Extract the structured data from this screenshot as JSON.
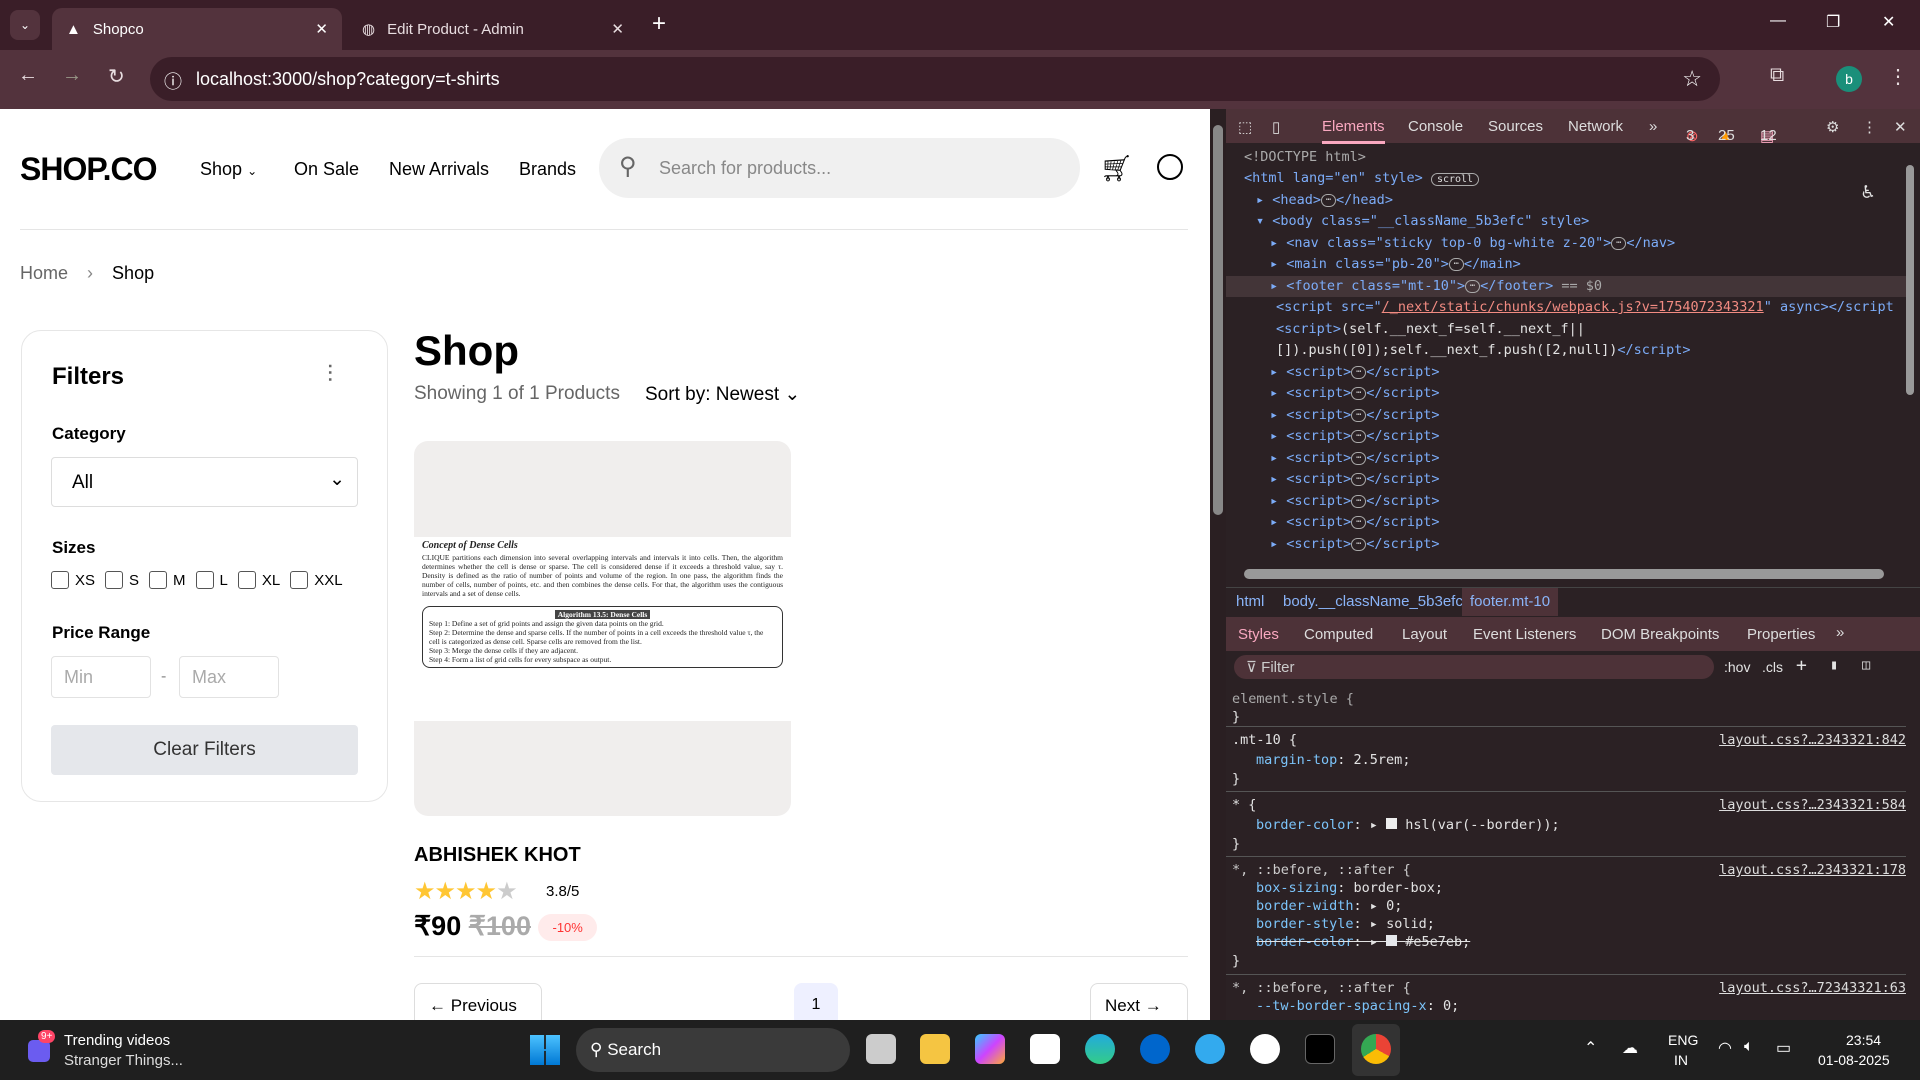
{
  "browser": {
    "tabs": [
      {
        "title": "Shopco",
        "active": true
      },
      {
        "title": "Edit Product - Admin",
        "active": false
      }
    ],
    "url": "localhost:3000/shop?category=t-shirts",
    "profile_initial": "b"
  },
  "site": {
    "logo": "SHOP.CO",
    "nav": [
      "Shop",
      "On Sale",
      "New Arrivals",
      "Brands"
    ],
    "search_placeholder": "Search for products...",
    "breadcrumb": [
      "Home",
      "Shop"
    ],
    "filters": {
      "title": "Filters",
      "category_label": "Category",
      "category_value": "All",
      "sizes_label": "Sizes",
      "sizes": [
        "XS",
        "S",
        "M",
        "L",
        "XL",
        "XXL"
      ],
      "price_label": "Price Range",
      "min_placeholder": "Min",
      "max_placeholder": "Max",
      "separator": "-",
      "clear": "Clear Filters"
    },
    "shop": {
      "title": "Shop",
      "showing": "Showing 1 of 1 Products",
      "sort_label": "Sort by:",
      "sort_value": "Newest"
    },
    "product": {
      "name": "ABHISHEK KHOT",
      "rating": 3.8,
      "rating_text": "3.8/5",
      "price": "₹90",
      "old_price": "₹100",
      "discount": "-10%",
      "image_text": {
        "heading": "Concept of Dense Cells",
        "para": "CLIQUE partitions each dimension into several overlapping intervals and intervals it into cells. Then, the algorithm determines whether the cell is dense or sparse. The cell is considered dense if it exceeds a threshold value, say τ. Density is defined as the ratio of number of points and volume of the region. In one pass, the algorithm finds the number of cells, number of points, etc. and then combines the dense cells. For that, the algorithm uses the contiguous intervals and a set of dense cells.",
        "algo_title": "Algorithm 13.5: Dense Cells",
        "steps": [
          "Step 1: Define a set of grid points and assign the given data points on the grid.",
          "Step 2: Determine the dense and sparse cells. If the number of points in a cell exceeds the threshold value τ, the cell is categorized as dense cell. Sparse cells are removed from the list.",
          "Step 3: Merge the dense cells if they are adjacent.",
          "Step 4: Form a list of grid cells for every subspace as output."
        ]
      }
    },
    "pagination": {
      "prev": "Previous",
      "page": "1",
      "next": "Next"
    }
  },
  "devtools": {
    "tabs": [
      "Elements",
      "Console",
      "Sources",
      "Network"
    ],
    "errors": "3",
    "warnings": "25",
    "messages": "12",
    "dom": [
      "<!DOCTYPE html>",
      "<html lang=\"en\" style>",
      "<head>",
      "<body class=\"__className_5b3efc\" style>",
      "<nav class=\"sticky top-0 bg-white z-20\">",
      "<main class=\"pb-20\">",
      "<footer class=\"mt-10\">",
      "/_next/static/chunks/webpack.js?v=1754072343321",
      "(self.__next_f=self.__next_f||",
      "[]).push([0]);self.__next_f.push([2,null])",
      "<script>"
    ],
    "scroll_badge": "scroll",
    "selected_suffix": "== $0",
    "crumbs": [
      "html",
      "body.__className_5b3efc",
      "footer.mt-10"
    ],
    "style_tabs": [
      "Styles",
      "Computed",
      "Layout",
      "Event Listeners",
      "DOM Breakpoints",
      "Properties"
    ],
    "filter_placeholder": "Filter",
    "hov": ":hov",
    "cls": ".cls",
    "rules": [
      {
        "selector": "element.style {",
        "source": "",
        "props": []
      },
      {
        "selector": ".mt-10 {",
        "source": "layout.css?…2343321:842",
        "props": [
          {
            "n": "margin-top",
            "v": "2.5rem;"
          }
        ]
      },
      {
        "selector": "* {",
        "source": "layout.css?…2343321:584",
        "props": [
          {
            "n": "border-color",
            "v": "hsl(var(--border));"
          }
        ]
      },
      {
        "selector": "*, ::before, ::after {",
        "source": "layout.css?…2343321:178",
        "props": [
          {
            "n": "box-sizing",
            "v": "border-box;"
          },
          {
            "n": "border-width",
            "v": "0;"
          },
          {
            "n": "border-style",
            "v": "solid;"
          },
          {
            "n": "border-color",
            "v": "#e5e7eb;",
            "struck": true
          }
        ]
      },
      {
        "selector": "*, ::before, ::after {",
        "source": "layout.css?…72343321:63",
        "props": [
          {
            "n": "--tw-border-spacing-x",
            "v": "0;"
          }
        ]
      }
    ]
  },
  "taskbar": {
    "widget_title": "Trending videos",
    "widget_sub": "Stranger Things...",
    "widget_badge": "9+",
    "search": "Search",
    "lang": "ENG",
    "region": "IN",
    "time": "23:54",
    "date": "01-08-2025"
  }
}
